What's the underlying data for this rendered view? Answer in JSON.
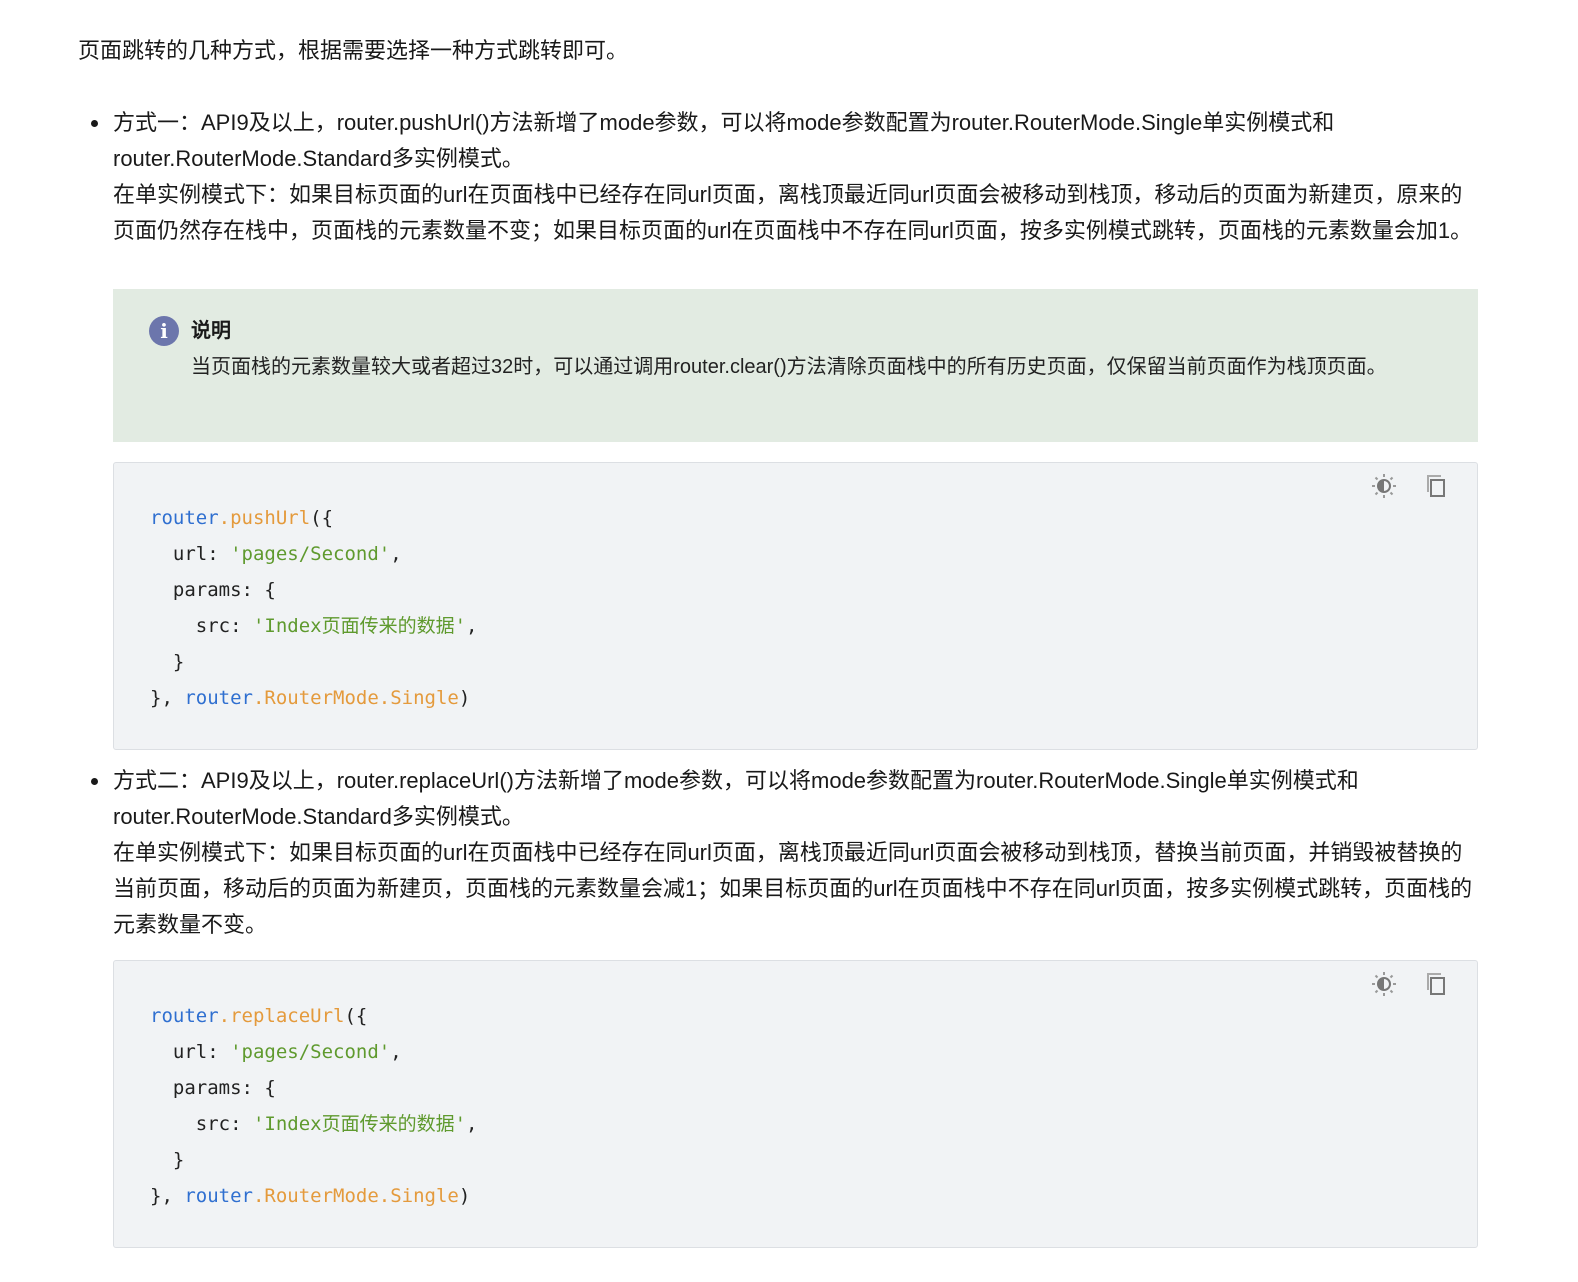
{
  "intro": "页面跳转的几种方式，根据需要选择一种方式跳转即可。",
  "bullets": [
    {
      "title": "方式一：API9及以上，router.pushUrl()方法新增了mode参数，可以将mode参数配置为router.RouterMode.Single单实例模式和router.RouterMode.Standard多实例模式。",
      "detail": "在单实例模式下：如果目标页面的url在页面栈中已经存在同url页面，离栈顶最近同url页面会被移动到栈顶，移动后的页面为新建页，原来的页面仍然存在栈中，页面栈的元素数量不变；如果目标页面的url在页面栈中不存在同url页面，按多实例模式跳转，页面栈的元素数量会加1。"
    },
    {
      "title": "方式二：API9及以上，router.replaceUrl()方法新增了mode参数，可以将mode参数配置为router.RouterMode.Single单实例模式和router.RouterMode.Standard多实例模式。",
      "detail": "在单实例模式下：如果目标页面的url在页面栈中已经存在同url页面，离栈顶最近同url页面会被移动到栈顶，替换当前页面，并销毁被替换的当前页面，移动后的页面为新建页，页面栈的元素数量会减1；如果目标页面的url在页面栈中不存在同url页面，按多实例模式跳转，页面栈的元素数量不变。"
    }
  ],
  "note": {
    "icon": "info-icon",
    "icon_glyph": "i",
    "title": "说明",
    "text": "当页面栈的元素数量较大或者超过32时，可以通过调用router.clear()方法清除页面栈中的所有历史页面，仅保留当前页面作为栈顶页面。"
  },
  "colors": {
    "object": "#2f6fd0",
    "method": "#e49a3c",
    "string": "#5f9a2e",
    "note_bg": "#e2ebe2",
    "code_bg": "#f1f3f5"
  },
  "code_blocks": [
    {
      "lines": [
        [
          [
            "obj",
            "router"
          ],
          [
            "fn",
            ".pushUrl"
          ],
          [
            "pl",
            "({"
          ]
        ],
        [
          [
            "pl",
            "  url: "
          ],
          [
            "str",
            "'pages/Second'"
          ],
          [
            "pl",
            ","
          ]
        ],
        [
          [
            "pl",
            "  params: {"
          ]
        ],
        [
          [
            "pl",
            "    src: "
          ],
          [
            "str",
            "'Index页面传来的数据'"
          ],
          [
            "pl",
            ","
          ]
        ],
        [
          [
            "pl",
            "  }"
          ]
        ],
        [
          [
            "pl",
            "}, "
          ],
          [
            "obj",
            "router"
          ],
          [
            "fn",
            ".RouterMode.Single"
          ],
          [
            "pl",
            ")"
          ]
        ]
      ]
    },
    {
      "lines": [
        [
          [
            "obj",
            "router"
          ],
          [
            "fn",
            ".replaceUrl"
          ],
          [
            "pl",
            "({"
          ]
        ],
        [
          [
            "pl",
            "  url: "
          ],
          [
            "str",
            "'pages/Second'"
          ],
          [
            "pl",
            ","
          ]
        ],
        [
          [
            "pl",
            "  params: {"
          ]
        ],
        [
          [
            "pl",
            "    src: "
          ],
          [
            "str",
            "'Index页面传来的数据'"
          ],
          [
            "pl",
            ","
          ]
        ],
        [
          [
            "pl",
            "  }"
          ]
        ],
        [
          [
            "pl",
            "}, "
          ],
          [
            "obj",
            "router"
          ],
          [
            "fn",
            ".RouterMode.Single"
          ],
          [
            "pl",
            ")"
          ]
        ]
      ]
    }
  ]
}
